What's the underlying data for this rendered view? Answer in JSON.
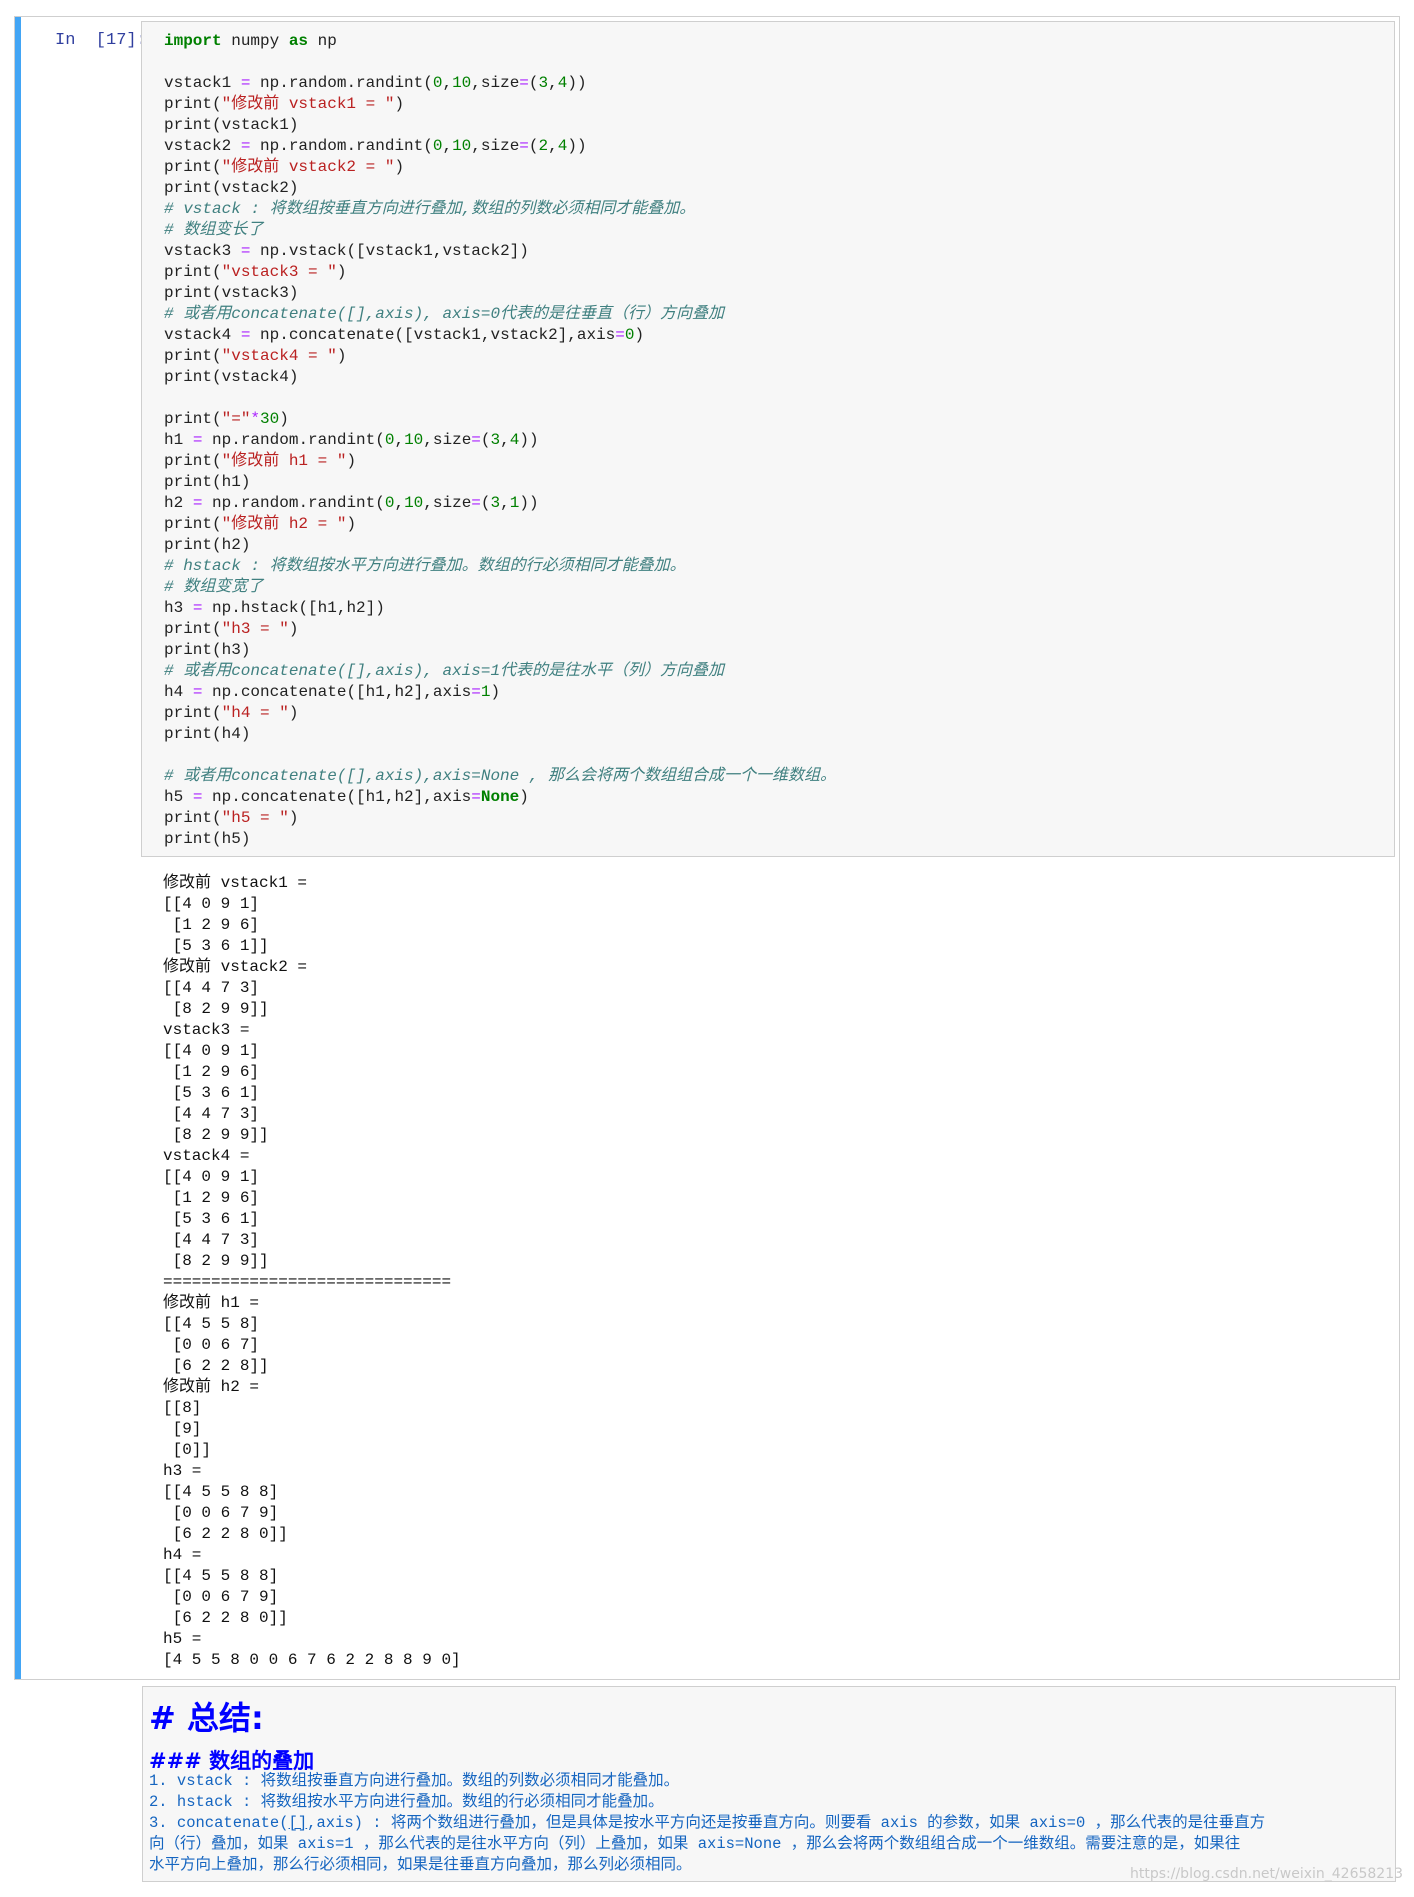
{
  "cell": {
    "prompt": "In  [17]:",
    "code": [
      [
        {
          "c": "kw",
          "t": "import"
        },
        {
          "c": "",
          "t": " numpy "
        },
        {
          "c": "kw",
          "t": "as"
        },
        {
          "c": "",
          "t": " np"
        }
      ],
      [],
      [
        {
          "c": "",
          "t": "vstack1 "
        },
        {
          "c": "op",
          "t": "="
        },
        {
          "c": "",
          "t": " np.random.randint("
        },
        {
          "c": "num",
          "t": "0"
        },
        {
          "c": "",
          "t": ","
        },
        {
          "c": "num",
          "t": "10"
        },
        {
          "c": "",
          "t": ",size"
        },
        {
          "c": "op",
          "t": "="
        },
        {
          "c": "",
          "t": "("
        },
        {
          "c": "num",
          "t": "3"
        },
        {
          "c": "",
          "t": ","
        },
        {
          "c": "num",
          "t": "4"
        },
        {
          "c": "",
          "t": "))"
        }
      ],
      [
        {
          "c": "",
          "t": "print("
        },
        {
          "c": "str",
          "t": "\"修改前 vstack1 = \""
        },
        {
          "c": "",
          "t": ")"
        }
      ],
      [
        {
          "c": "",
          "t": "print(vstack1)"
        }
      ],
      [
        {
          "c": "",
          "t": "vstack2 "
        },
        {
          "c": "op",
          "t": "="
        },
        {
          "c": "",
          "t": " np.random.randint("
        },
        {
          "c": "num",
          "t": "0"
        },
        {
          "c": "",
          "t": ","
        },
        {
          "c": "num",
          "t": "10"
        },
        {
          "c": "",
          "t": ",size"
        },
        {
          "c": "op",
          "t": "="
        },
        {
          "c": "",
          "t": "("
        },
        {
          "c": "num",
          "t": "2"
        },
        {
          "c": "",
          "t": ","
        },
        {
          "c": "num",
          "t": "4"
        },
        {
          "c": "",
          "t": "))"
        }
      ],
      [
        {
          "c": "",
          "t": "print("
        },
        {
          "c": "str",
          "t": "\"修改前 vstack2 = \""
        },
        {
          "c": "",
          "t": ")"
        }
      ],
      [
        {
          "c": "",
          "t": "print(vstack2)"
        }
      ],
      [
        {
          "c": "cm",
          "t": "# vstack : 将数组按垂直方向进行叠加,数组的列数必须相同才能叠加。"
        }
      ],
      [
        {
          "c": "cm",
          "t": "# 数组变长了"
        }
      ],
      [
        {
          "c": "",
          "t": "vstack3 "
        },
        {
          "c": "op",
          "t": "="
        },
        {
          "c": "",
          "t": " np.vstack([vstack1,vstack2])"
        }
      ],
      [
        {
          "c": "",
          "t": "print("
        },
        {
          "c": "str",
          "t": "\"vstack3 = \""
        },
        {
          "c": "",
          "t": ")"
        }
      ],
      [
        {
          "c": "",
          "t": "print(vstack3)"
        }
      ],
      [
        {
          "c": "cm",
          "t": "# 或者用concatenate([],axis), axis=0代表的是往垂直（行）方向叠加"
        }
      ],
      [
        {
          "c": "",
          "t": "vstack4 "
        },
        {
          "c": "op",
          "t": "="
        },
        {
          "c": "",
          "t": " np.concatenate([vstack1,vstack2],axis"
        },
        {
          "c": "op",
          "t": "="
        },
        {
          "c": "num",
          "t": "0"
        },
        {
          "c": "",
          "t": ")"
        }
      ],
      [
        {
          "c": "",
          "t": "print("
        },
        {
          "c": "str",
          "t": "\"vstack4 = \""
        },
        {
          "c": "",
          "t": ")"
        }
      ],
      [
        {
          "c": "",
          "t": "print(vstack4)"
        }
      ],
      [],
      [
        {
          "c": "",
          "t": "print("
        },
        {
          "c": "str",
          "t": "\"=\""
        },
        {
          "c": "op",
          "t": "*"
        },
        {
          "c": "num",
          "t": "30"
        },
        {
          "c": "",
          "t": ")"
        }
      ],
      [
        {
          "c": "",
          "t": "h1 "
        },
        {
          "c": "op",
          "t": "="
        },
        {
          "c": "",
          "t": " np.random.randint("
        },
        {
          "c": "num",
          "t": "0"
        },
        {
          "c": "",
          "t": ","
        },
        {
          "c": "num",
          "t": "10"
        },
        {
          "c": "",
          "t": ",size"
        },
        {
          "c": "op",
          "t": "="
        },
        {
          "c": "",
          "t": "("
        },
        {
          "c": "num",
          "t": "3"
        },
        {
          "c": "",
          "t": ","
        },
        {
          "c": "num",
          "t": "4"
        },
        {
          "c": "",
          "t": "))"
        }
      ],
      [
        {
          "c": "",
          "t": "print("
        },
        {
          "c": "str",
          "t": "\"修改前 h1 = \""
        },
        {
          "c": "",
          "t": ")"
        }
      ],
      [
        {
          "c": "",
          "t": "print(h1)"
        }
      ],
      [
        {
          "c": "",
          "t": "h2 "
        },
        {
          "c": "op",
          "t": "="
        },
        {
          "c": "",
          "t": " np.random.randint("
        },
        {
          "c": "num",
          "t": "0"
        },
        {
          "c": "",
          "t": ","
        },
        {
          "c": "num",
          "t": "10"
        },
        {
          "c": "",
          "t": ",size"
        },
        {
          "c": "op",
          "t": "="
        },
        {
          "c": "",
          "t": "("
        },
        {
          "c": "num",
          "t": "3"
        },
        {
          "c": "",
          "t": ","
        },
        {
          "c": "num",
          "t": "1"
        },
        {
          "c": "",
          "t": "))"
        }
      ],
      [
        {
          "c": "",
          "t": "print("
        },
        {
          "c": "str",
          "t": "\"修改前 h2 = \""
        },
        {
          "c": "",
          "t": ")"
        }
      ],
      [
        {
          "c": "",
          "t": "print(h2)"
        }
      ],
      [
        {
          "c": "cm",
          "t": "# hstack : 将数组按水平方向进行叠加。数组的行必须相同才能叠加。"
        }
      ],
      [
        {
          "c": "cm",
          "t": "# 数组变宽了"
        }
      ],
      [
        {
          "c": "",
          "t": "h3 "
        },
        {
          "c": "op",
          "t": "="
        },
        {
          "c": "",
          "t": " np.hstack([h1,h2])"
        }
      ],
      [
        {
          "c": "",
          "t": "print("
        },
        {
          "c": "str",
          "t": "\"h3 = \""
        },
        {
          "c": "",
          "t": ")"
        }
      ],
      [
        {
          "c": "",
          "t": "print(h3)"
        }
      ],
      [
        {
          "c": "cm",
          "t": "# 或者用concatenate([],axis), axis=1代表的是往水平（列）方向叠加"
        }
      ],
      [
        {
          "c": "",
          "t": "h4 "
        },
        {
          "c": "op",
          "t": "="
        },
        {
          "c": "",
          "t": " np.concatenate([h1,h2],axis"
        },
        {
          "c": "op",
          "t": "="
        },
        {
          "c": "num",
          "t": "1"
        },
        {
          "c": "",
          "t": ")"
        }
      ],
      [
        {
          "c": "",
          "t": "print("
        },
        {
          "c": "str",
          "t": "\"h4 = \""
        },
        {
          "c": "",
          "t": ")"
        }
      ],
      [
        {
          "c": "",
          "t": "print(h4)"
        }
      ],
      [],
      [
        {
          "c": "cm",
          "t": "# 或者用concatenate([],axis),axis=None , 那么会将两个数组组合成一个一维数组。"
        }
      ],
      [
        {
          "c": "",
          "t": "h5 "
        },
        {
          "c": "op",
          "t": "="
        },
        {
          "c": "",
          "t": " np.concatenate([h1,h2],axis"
        },
        {
          "c": "op",
          "t": "="
        },
        {
          "c": "kw",
          "t": "None"
        },
        {
          "c": "",
          "t": ")"
        }
      ],
      [
        {
          "c": "",
          "t": "print("
        },
        {
          "c": "str",
          "t": "\"h5 = \""
        },
        {
          "c": "",
          "t": ")"
        }
      ],
      [
        {
          "c": "",
          "t": "print(h5)"
        }
      ]
    ],
    "output": [
      "修改前 vstack1 =",
      "[[4 0 9 1]",
      " [1 2 9 6]",
      " [5 3 6 1]]",
      "修改前 vstack2 =",
      "[[4 4 7 3]",
      " [8 2 9 9]]",
      "vstack3 =",
      "[[4 0 9 1]",
      " [1 2 9 6]",
      " [5 3 6 1]",
      " [4 4 7 3]",
      " [8 2 9 9]]",
      "vstack4 =",
      "[[4 0 9 1]",
      " [1 2 9 6]",
      " [5 3 6 1]",
      " [4 4 7 3]",
      " [8 2 9 9]]",
      "==============================",
      "修改前 h1 =",
      "[[4 5 5 8]",
      " [0 0 6 7]",
      " [6 2 2 8]]",
      "修改前 h2 =",
      "[[8]",
      " [9]",
      " [0]]",
      "h3 =",
      "[[4 5 5 8 8]",
      " [0 0 6 7 9]",
      " [6 2 2 8 0]]",
      "h4 =",
      "[[4 5 5 8 8]",
      " [0 0 6 7 9]",
      " [6 2 2 8 0]]",
      "h5 =",
      "[4 5 5 8 0 0 6 7 6 2 2 8 8 9 0]"
    ]
  },
  "markdown": {
    "h1": "# 总结:",
    "h3": "### 数组的叠加",
    "lines": [
      [
        {
          "c": "",
          "t": "1. vstack : 将数组按垂直方向进行叠加。数组的列数必须相同才能叠加。"
        }
      ],
      [
        {
          "c": "",
          "t": "2. hstack : 将数组按水平方向进行叠加。数组的行必须相同才能叠加。"
        }
      ],
      [
        {
          "c": "",
          "t": "3. concatenate("
        },
        {
          "c": "link",
          "t": "[]"
        },
        {
          "c": "",
          "t": ",axis) : 将两个数组进行叠加，但是具体是按水平方向还是按垂直方向。则要看 axis 的参数，如果 axis=0 ，那么代表的是往垂直方"
        }
      ],
      [
        {
          "c": "",
          "t": "向（行）叠加，如果 axis=1 ，那么代表的是往水平方向（列）上叠加，如果 axis=None ，那么会将两个数组组合成一个一维数组。需要注意的是，如果往"
        }
      ],
      [
        {
          "c": "",
          "t": "水平方向上叠加，那么行必须相同，如果是往垂直方向叠加，那么列必须相同。"
        }
      ]
    ]
  },
  "watermark": "https://blog.csdn.net/weixin_42658213"
}
